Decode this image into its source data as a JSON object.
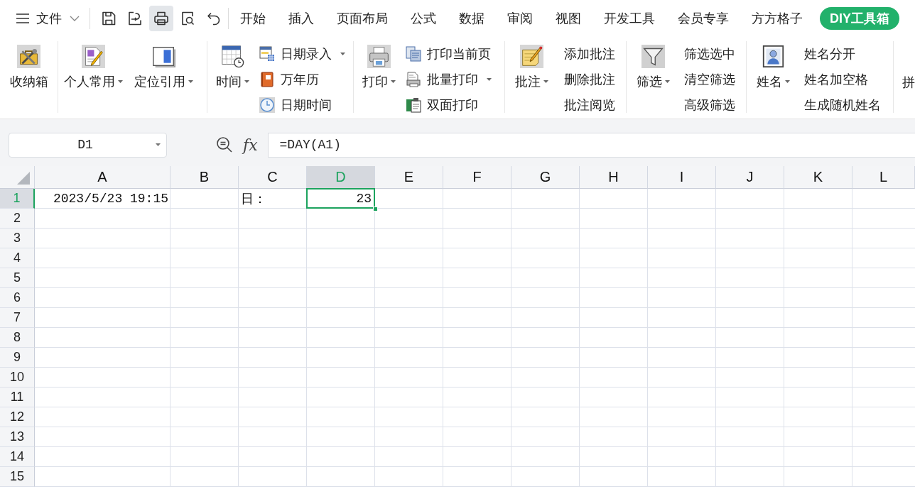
{
  "menu": {
    "label": "文件"
  },
  "quick_access": [
    {
      "hovered": false
    },
    {
      "hovered": false
    },
    {
      "hovered": true
    },
    {
      "hovered": false
    },
    {
      "hovered": false
    }
  ],
  "tabs": [
    {
      "label": "开始",
      "selected": false
    },
    {
      "label": "插入",
      "selected": false
    },
    {
      "label": "页面布局",
      "selected": false
    },
    {
      "label": "公式",
      "selected": false
    },
    {
      "label": "数据",
      "selected": false
    },
    {
      "label": "审阅",
      "selected": false
    },
    {
      "label": "视图",
      "selected": false
    },
    {
      "label": "开发工具",
      "selected": false
    },
    {
      "label": "会员专享",
      "selected": false
    },
    {
      "label": "方方格子",
      "selected": false
    },
    {
      "label": "DIY工具箱",
      "selected": true
    }
  ],
  "ribbon": {
    "groups": [
      {
        "items": [
          {
            "kind": "large",
            "label": "收纳箱",
            "dropdown": false
          }
        ]
      },
      {
        "items": [
          {
            "kind": "large",
            "label": "个人常用",
            "dropdown": true
          },
          {
            "kind": "large",
            "label": "定位引用",
            "dropdown": true
          }
        ]
      },
      {
        "items": [
          {
            "kind": "large",
            "label": "时间",
            "dropdown": true
          },
          {
            "kind": "small",
            "label": "日期录入",
            "dropdown": true
          },
          {
            "kind": "small",
            "label": "万年历",
            "dropdown": false
          },
          {
            "kind": "small",
            "label": "日期时间",
            "dropdown": false
          }
        ]
      },
      {
        "items": [
          {
            "kind": "large",
            "label": "打印",
            "dropdown": true
          },
          {
            "kind": "small",
            "label": "打印当前页",
            "dropdown": false
          },
          {
            "kind": "small",
            "label": "批量打印",
            "dropdown": true
          },
          {
            "kind": "small",
            "label": "双面打印",
            "dropdown": false
          }
        ]
      },
      {
        "items": [
          {
            "kind": "large",
            "label": "批注",
            "dropdown": true
          },
          {
            "kind": "small",
            "label": "添加批注",
            "dropdown": false
          },
          {
            "kind": "small",
            "label": "删除批注",
            "dropdown": false
          },
          {
            "kind": "small",
            "label": "批注阅览",
            "dropdown": false
          }
        ]
      },
      {
        "items": [
          {
            "kind": "large",
            "label": "筛选",
            "dropdown": true
          },
          {
            "kind": "small",
            "label": "筛选选中",
            "dropdown": false
          },
          {
            "kind": "small",
            "label": "清空筛选",
            "dropdown": false
          },
          {
            "kind": "small",
            "label": "高级筛选",
            "dropdown": false
          }
        ]
      },
      {
        "items": [
          {
            "kind": "large",
            "label": "姓名",
            "dropdown": true
          },
          {
            "kind": "small",
            "label": "姓名分开",
            "dropdown": false
          },
          {
            "kind": "small",
            "label": "姓名加空格",
            "dropdown": false
          },
          {
            "kind": "small",
            "label": "生成随机姓名",
            "dropdown": false
          }
        ]
      },
      {
        "items": [
          {
            "kind": "large",
            "label": "拼",
            "dropdown": false
          }
        ]
      }
    ]
  },
  "formula_bar": {
    "name_box": "D1",
    "function_button": "fx",
    "formula": "=DAY(A1)"
  },
  "sheet": {
    "columns": [
      {
        "label": "A",
        "selected": false
      },
      {
        "label": "B",
        "selected": false
      },
      {
        "label": "C",
        "selected": false
      },
      {
        "label": "D",
        "selected": true
      },
      {
        "label": "E",
        "selected": false
      },
      {
        "label": "F",
        "selected": false
      },
      {
        "label": "G",
        "selected": false
      },
      {
        "label": "H",
        "selected": false
      },
      {
        "label": "I",
        "selected": false
      },
      {
        "label": "J",
        "selected": false
      },
      {
        "label": "K",
        "selected": false
      },
      {
        "label": "L",
        "selected": false
      }
    ],
    "rows": [
      {
        "label": "1",
        "selected": true,
        "cells": [
          {
            "kind": "number",
            "value": "2023/5/23 19:15",
            "selected": false
          },
          null,
          {
            "kind": "text",
            "value": "日：",
            "selected": false
          },
          {
            "kind": "number",
            "value": "23",
            "selected": true
          }
        ]
      },
      {
        "label": "2",
        "selected": false
      },
      {
        "label": "3",
        "selected": false
      },
      {
        "label": "4",
        "selected": false
      },
      {
        "label": "5",
        "selected": false
      },
      {
        "label": "6",
        "selected": false
      },
      {
        "label": "7",
        "selected": false
      },
      {
        "label": "8",
        "selected": false
      },
      {
        "label": "9",
        "selected": false
      },
      {
        "label": "10",
        "selected": false
      },
      {
        "label": "11",
        "selected": false
      },
      {
        "label": "12",
        "selected": false
      },
      {
        "label": "13",
        "selected": false
      },
      {
        "label": "14",
        "selected": false
      },
      {
        "label": "15",
        "selected": false
      }
    ]
  }
}
